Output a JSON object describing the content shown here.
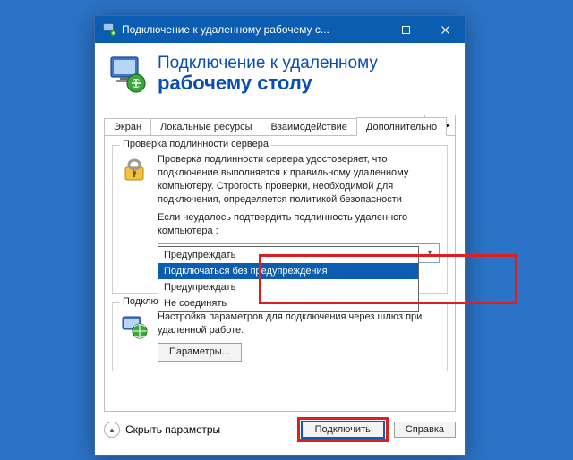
{
  "titlebar": {
    "title": "Подключение к удаленному рабочему с..."
  },
  "header": {
    "line1": "Подключение к удаленному",
    "line2": "рабочему столу"
  },
  "tabs": {
    "items": [
      {
        "label": "Экран"
      },
      {
        "label": "Локальные ресурсы"
      },
      {
        "label": "Взаимодействие"
      },
      {
        "label": "Дополнительно"
      }
    ],
    "selected_index": 3
  },
  "group_auth": {
    "legend": "Проверка подлинности сервера",
    "desc": "Проверка подлинности сервера удостоверяет, что подключение выполняется к правильному удаленному компьютеру. Строгость проверки, необходимой для подключения, определяется политикой безопасности",
    "prompt": "Если неудалось подтвердить подлинность удаленного компьютера :",
    "combo_value": "Предупреждать",
    "dropdown": [
      "Предупреждать",
      "Подключаться без предупреждения",
      "Предупреждать",
      "Не соединять"
    ],
    "dropdown_selected": 1
  },
  "group_gateway": {
    "legend": "Подключение из любого места",
    "desc": "Настройка параметров для подключения через шлюз при удаленной работе.",
    "button": "Параметры..."
  },
  "bottom": {
    "toggle": "Скрыть параметры",
    "connect": "Подключить",
    "help": "Справка"
  }
}
